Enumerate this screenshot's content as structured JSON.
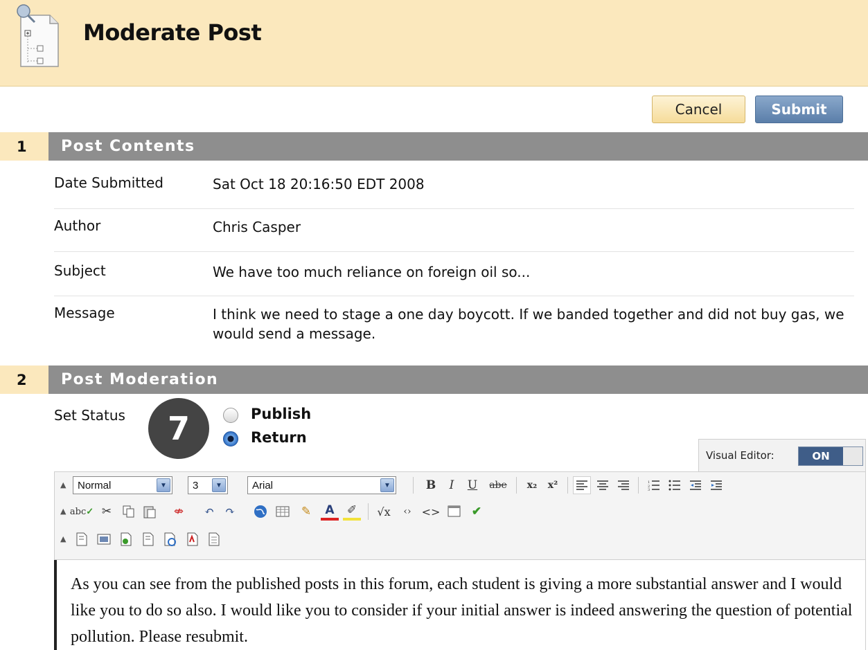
{
  "header": {
    "title": "Moderate Post"
  },
  "actions": {
    "cancel_label": "Cancel",
    "submit_label": "Submit"
  },
  "section1": {
    "number": "1",
    "title": "Post Contents",
    "fields": [
      {
        "label": "Date Submitted",
        "value": "Sat Oct 18 20:16:50 EDT 2008"
      },
      {
        "label": "Author",
        "value": "Chris Casper"
      },
      {
        "label": "Subject",
        "value": "We have too much reliance on foreign oil so..."
      },
      {
        "label": "Message",
        "value": "I think we need to stage a one day boycott. If we banded together and did not buy gas, we would send a message."
      }
    ]
  },
  "section2": {
    "number": "2",
    "title": "Post Moderation",
    "status_label": "Set Status",
    "step_marker": "7",
    "options": [
      {
        "label": "Publish",
        "selected": false
      },
      {
        "label": "Return",
        "selected": true
      }
    ]
  },
  "visual_editor": {
    "label": "Visual Editor:",
    "state": "ON"
  },
  "toolbar": {
    "paragraph_format": "Normal",
    "font_size": "3",
    "font_family": "Arial",
    "row1_icons": [
      "bold-icon",
      "italic-icon",
      "underline-icon",
      "strikethrough-icon",
      "subscript-icon",
      "superscript-icon",
      "align-left-icon",
      "align-center-icon",
      "align-right-icon",
      "ordered-list-icon",
      "unordered-list-icon",
      "outdent-icon",
      "indent-icon"
    ],
    "row2_icons": [
      "spellcheck-icon",
      "cut-icon",
      "copy-icon",
      "paste-icon",
      "unlink-icon",
      "undo-icon",
      "redo-icon",
      "link-globe-icon",
      "table-icon",
      "pencil-icon",
      "text-color-icon",
      "highlight-icon",
      "math-icon",
      "embed-icon",
      "html-source-icon",
      "preview-icon",
      "check-icon"
    ],
    "row3_icons": [
      "attach-file-icon",
      "insert-image-icon",
      "insert-media-icon",
      "preview-page-icon",
      "insert-audio-icon",
      "insert-pdf-icon",
      "mashup-icon"
    ],
    "glyphs": {
      "bold": "B",
      "italic": "I",
      "underline": "U",
      "strike": "abe",
      "sub": "x₂",
      "sup": "x²",
      "spell": "abc",
      "text_color": "A",
      "math": "√x",
      "embed": "‹›",
      "source": "<>"
    }
  },
  "editor": {
    "content": "As you can see from the published posts in this forum, each student is giving a more substantial answer and I would like you to do so also. I would like you to consider if your initial answer is indeed answering the question of potential pollution. Please resubmit."
  },
  "colors": {
    "header_bg": "#fbe8bd",
    "section_bar": "#8e8e8e",
    "submit_bg": "#5a7ea9",
    "ve_on": "#3f5d88"
  }
}
